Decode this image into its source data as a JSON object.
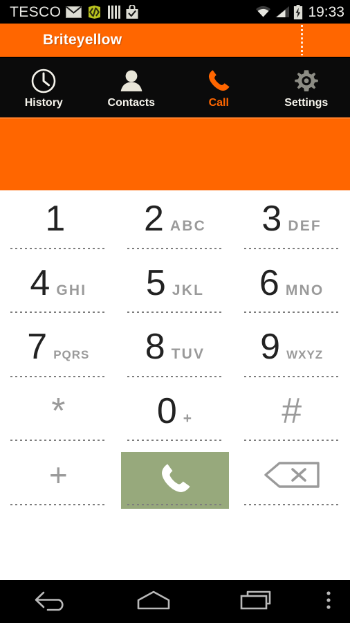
{
  "status_bar": {
    "carrier": "TESCO",
    "time": "19:33",
    "left_icons": [
      "mail-icon",
      "developer-icon",
      "bars-icon",
      "play-store-icon"
    ],
    "right_icons": [
      "wifi-icon",
      "signal-icon",
      "battery-charging-icon"
    ],
    "background_color": "#000000",
    "text_color": "#e8e8e4"
  },
  "app_bar": {
    "title": "Briteyellow",
    "background_color": "#ff6600",
    "title_color": "#ffffff"
  },
  "tabs": [
    {
      "label": "History",
      "icon": "clock-icon",
      "active": false
    },
    {
      "label": "Contacts",
      "icon": "person-icon",
      "active": false
    },
    {
      "label": "Call",
      "icon": "phone-icon",
      "active": true
    },
    {
      "label": "Settings",
      "icon": "gear-icon",
      "active": false
    }
  ],
  "active_tab_color": "#ff6600",
  "number_display": {
    "value": "",
    "placeholder": "",
    "background_color": "#ff6600"
  },
  "keypad": {
    "rows": [
      [
        {
          "digit": "1",
          "letters": "",
          "type": "digit"
        },
        {
          "digit": "2",
          "letters": "ABC",
          "type": "digit"
        },
        {
          "digit": "3",
          "letters": "DEF",
          "type": "digit"
        }
      ],
      [
        {
          "digit": "4",
          "letters": "GHI",
          "type": "digit"
        },
        {
          "digit": "5",
          "letters": "JKL",
          "type": "digit"
        },
        {
          "digit": "6",
          "letters": "MNO",
          "type": "digit"
        }
      ],
      [
        {
          "digit": "7",
          "letters": "PQRS",
          "type": "digit"
        },
        {
          "digit": "8",
          "letters": "TUV",
          "type": "digit"
        },
        {
          "digit": "9",
          "letters": "WXYZ",
          "type": "digit"
        }
      ],
      [
        {
          "digit": "*",
          "letters": "",
          "type": "symbol"
        },
        {
          "digit": "0",
          "letters": "+",
          "type": "digit"
        },
        {
          "digit": "#",
          "letters": "",
          "type": "symbol"
        }
      ]
    ],
    "action_row": {
      "plus_label": "+",
      "call_icon": "phone-handset-icon",
      "call_button_color": "#97a97c",
      "delete_icon": "backspace-icon"
    },
    "digit_color": "#222222",
    "letters_color": "#9a9a9a"
  },
  "nav_bar": {
    "buttons": [
      {
        "name": "back",
        "icon": "back-arrow-icon"
      },
      {
        "name": "home",
        "icon": "home-icon"
      },
      {
        "name": "recents",
        "icon": "recents-icon"
      },
      {
        "name": "menu",
        "icon": "overflow-menu-icon"
      }
    ],
    "background_color": "#000000"
  }
}
